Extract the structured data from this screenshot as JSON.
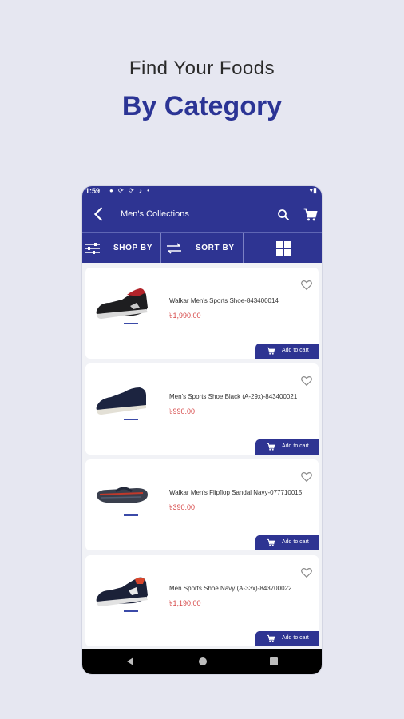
{
  "promo": {
    "line1": "Find Your Foods",
    "line2": "By Category"
  },
  "statusbar": {
    "time": "1:59",
    "icons": "● ⟳ ⟳ ♪ •",
    "right": "▾▮"
  },
  "appbar": {
    "title": "Men's Collections"
  },
  "filters": {
    "shop_by": "SHOP BY",
    "sort_by": "SORT BY"
  },
  "products": [
    {
      "name": "Walkar Men's Sports Shoe-843400014",
      "price": "৳1,990.00",
      "add_label": "Add to cart"
    },
    {
      "name": "Men's Sports Shoe Black (A-29x)-843400021",
      "price": "৳990.00",
      "add_label": "Add to cart"
    },
    {
      "name": "Walkar Men's Flipflop Sandal Navy-077710015",
      "price": "৳390.00",
      "add_label": "Add to cart"
    },
    {
      "name": "Men Sports Shoe Navy (A-33x)-843700022",
      "price": "৳1,190.00",
      "add_label": "Add to cart"
    }
  ],
  "colors": {
    "primary": "#2e3492",
    "price": "#d64848",
    "background": "#e6e7f1"
  }
}
